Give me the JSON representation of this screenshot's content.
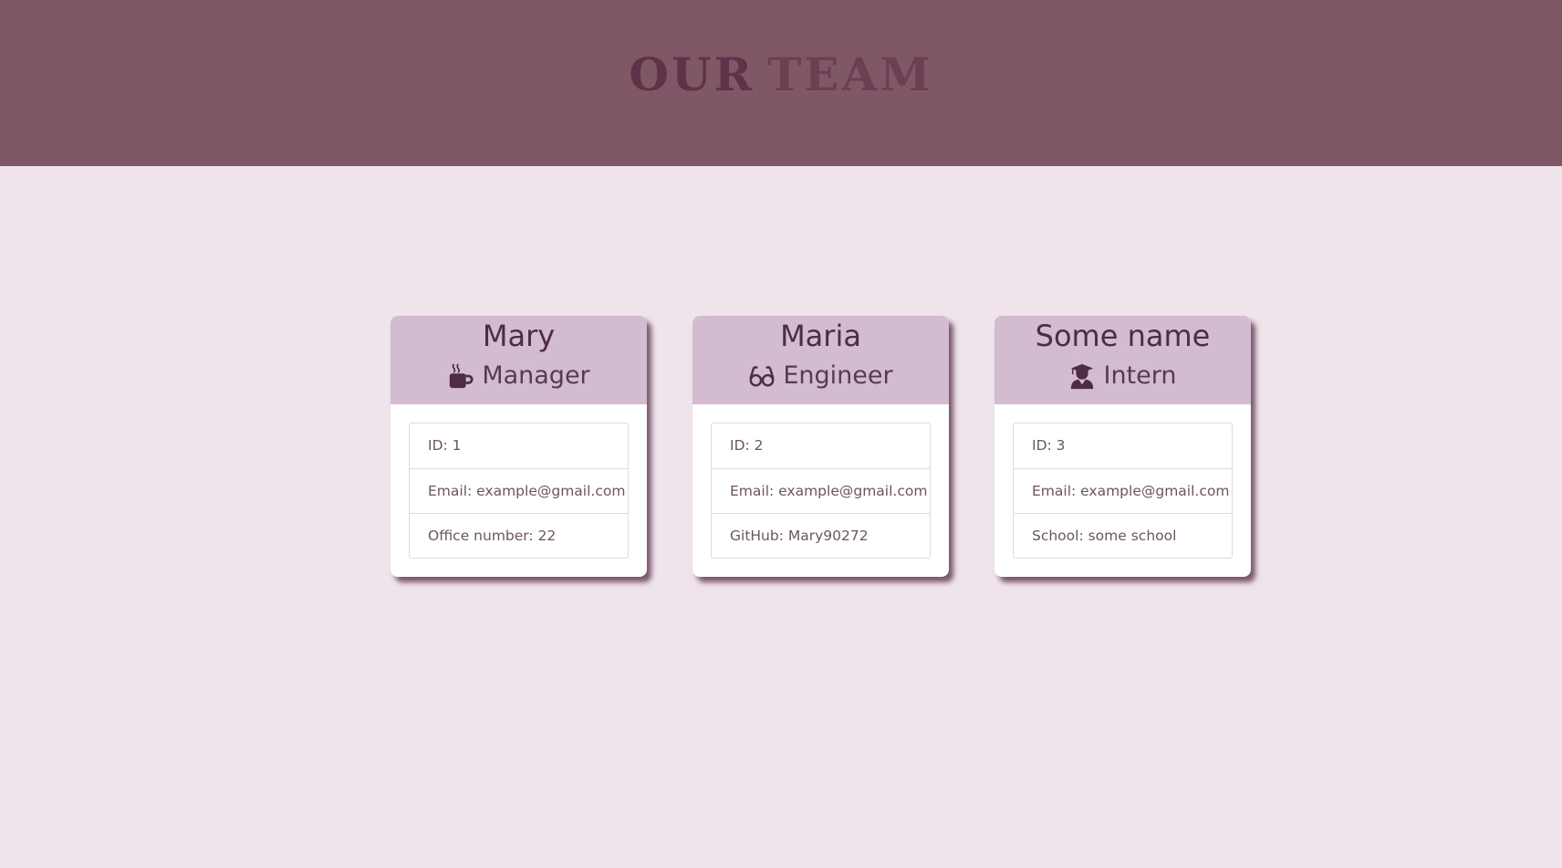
{
  "header": {
    "title_word_1": "OUR",
    "title_word_2": "TEAM"
  },
  "colors": {
    "header_bg": "#7f5765",
    "page_bg": "#efe3ec",
    "card_header_bg": "#d4bcd0",
    "text_dark": "#4f2c44"
  },
  "team": [
    {
      "name": "Mary",
      "role": "Manager",
      "role_icon": "coffee-mug-icon",
      "details": [
        "ID: 1",
        "Email: example@gmail.com",
        "Office number: 22"
      ]
    },
    {
      "name": "Maria",
      "role": "Engineer",
      "role_icon": "glasses-icon",
      "details": [
        "ID: 2",
        "Email: example@gmail.com",
        "GitHub: Mary90272"
      ]
    },
    {
      "name": "Some name",
      "role": "Intern",
      "role_icon": "graduate-user-icon",
      "details": [
        "ID: 3",
        "Email: example@gmail.com",
        "School: some school"
      ]
    }
  ]
}
